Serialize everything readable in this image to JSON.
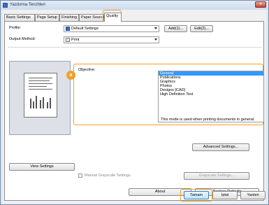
{
  "window": {
    "title": "Yazdırma Tercihleri",
    "close_glyph": "✕"
  },
  "tabs": [
    {
      "label": "Basic Settings"
    },
    {
      "label": "Page Setup"
    },
    {
      "label": "Finishing"
    },
    {
      "label": "Paper Source"
    },
    {
      "label": "Quality"
    }
  ],
  "profile": {
    "label": "Profile:",
    "value": "Default Settings",
    "add_label": "Add(1)...",
    "edit_label": "Edit(2)..."
  },
  "output": {
    "label": "Output Method:",
    "value": "Print"
  },
  "callout_badge": "a",
  "objective": {
    "label": "Objective:",
    "options": [
      "General",
      "Publications",
      "Graphics",
      "Photos",
      "Designs [CAD]",
      "High Definition Text"
    ],
    "selected_index": 0,
    "description": "This mode is used when printing documents in general."
  },
  "buttons": {
    "advanced": "Advanced Settings...",
    "view_settings": "View Settings",
    "grayscale_settings": "Grayscale Settings...",
    "about": "About",
    "restore_defaults": "Restore Defaults",
    "ok": "Tamam",
    "cancel": "İptal",
    "help": "Yardım"
  },
  "manual_grayscale": {
    "label": "Manual Grayscale Settings",
    "checked": false
  },
  "colors": {
    "highlight": "#f0a028",
    "selection": "#3399ff"
  }
}
